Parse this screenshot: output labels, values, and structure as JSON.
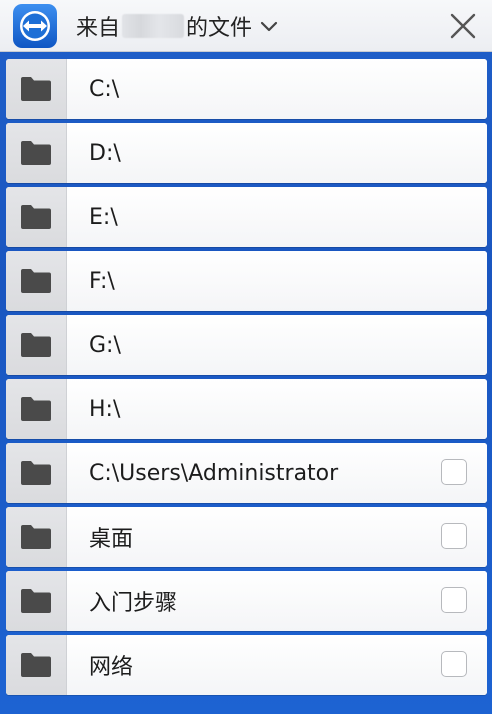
{
  "header": {
    "title_prefix": "来自",
    "title_suffix": "的文件",
    "app_icon": "teamviewer-logo-icon",
    "dropdown_icon": "chevron-down-icon",
    "close_icon": "close-icon"
  },
  "colors": {
    "background": "#1a56c0",
    "header": "#eceef2",
    "folder": "#4a4a4a",
    "logo_blue": "#1d6fd6"
  },
  "items": [
    {
      "label": "C:\\",
      "checkbox": false
    },
    {
      "label": "D:\\",
      "checkbox": false
    },
    {
      "label": "E:\\",
      "checkbox": false
    },
    {
      "label": "F:\\",
      "checkbox": false
    },
    {
      "label": "G:\\",
      "checkbox": false
    },
    {
      "label": "H:\\",
      "checkbox": false
    },
    {
      "label": "C:\\Users\\Administrator",
      "checkbox": true
    },
    {
      "label": "桌面",
      "checkbox": true
    },
    {
      "label": "入门步骤",
      "checkbox": true
    },
    {
      "label": "网络",
      "checkbox": true
    }
  ]
}
